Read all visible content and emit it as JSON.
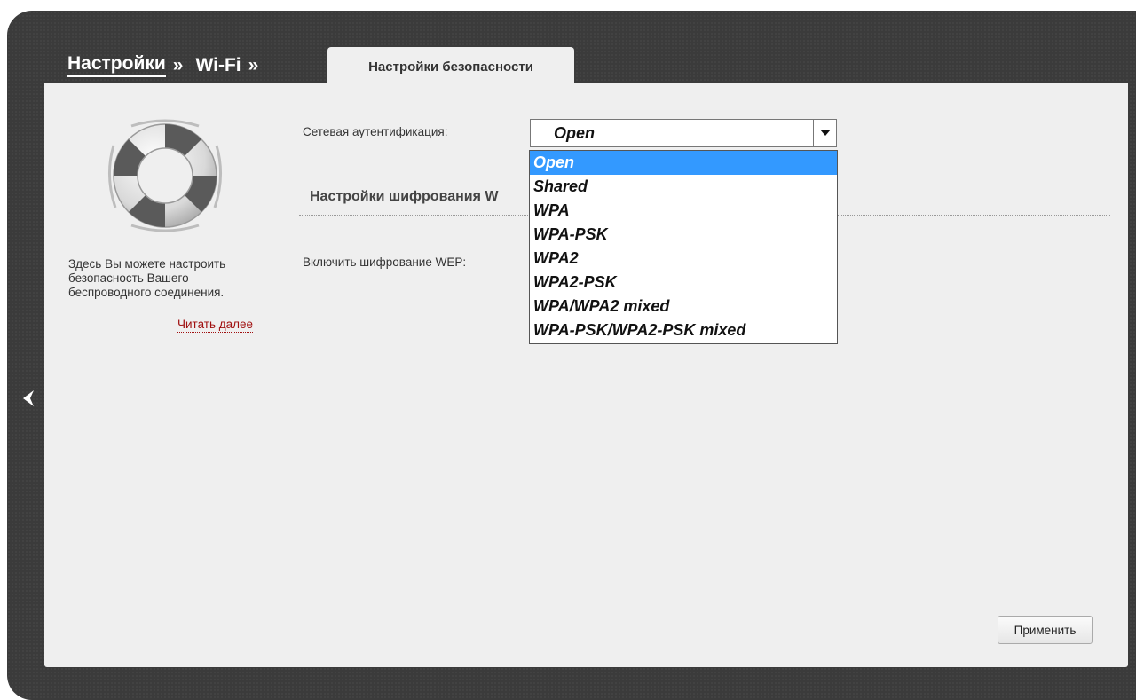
{
  "breadcrumb": {
    "item1": "Настройки",
    "sep1": "»",
    "item2": "Wi-Fi",
    "sep2": "»"
  },
  "active_tab": "Настройки безопасности",
  "sidebar": {
    "help_text": "Здесь Вы можете настроить безопасность Вашего беспроводного соединения.",
    "read_more": "Читать далее",
    "icon": "lifebuoy-icon"
  },
  "form": {
    "auth_label": "Сетевая аутентификация:",
    "auth_value": "Open",
    "auth_options": [
      "Open",
      "Shared",
      "WPA",
      "WPA-PSK",
      "WPA2",
      "WPA2-PSK",
      "WPA/WPA2 mixed",
      "WPA-PSK/WPA2-PSK mixed"
    ],
    "section_title": "Настройки шифрования W",
    "wep_label": "Включить шифрование WEP:"
  },
  "apply_button": "Применить",
  "colors": {
    "frame": "#3b3b3b",
    "panel": "#efefef",
    "selection": "#3399ff",
    "link": "#a01010"
  }
}
